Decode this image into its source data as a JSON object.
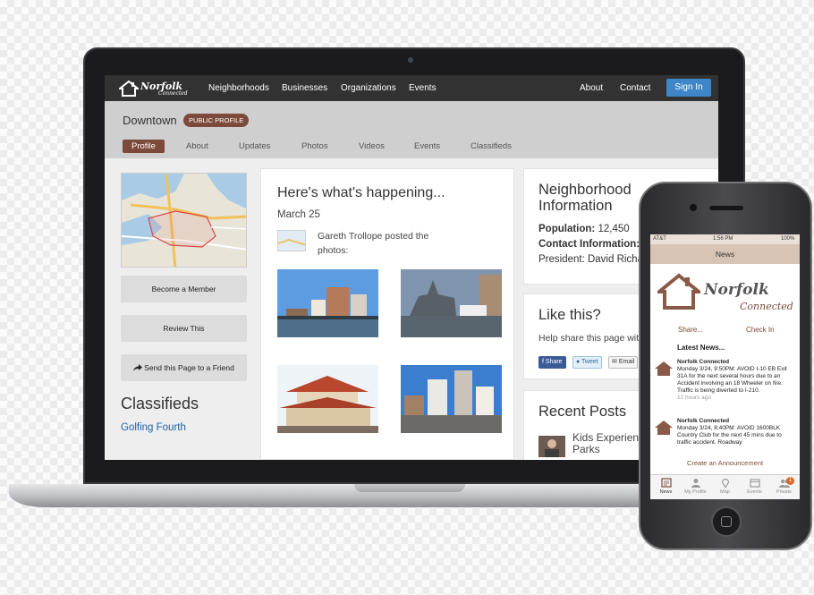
{
  "colors": {
    "brand_brown": "#7b4a3a",
    "nav_dark": "#323232",
    "signin_blue": "#3f86c8",
    "link_blue": "#1e62a6"
  },
  "site": {
    "brand_top": "Norfolk",
    "brand_bottom": "Connected",
    "nav": [
      "Neighborhoods",
      "Businesses",
      "Organizations",
      "Events"
    ],
    "about": "About",
    "contact": "Contact",
    "signin": "Sign In"
  },
  "page": {
    "title": "Downtown",
    "badge": "PUBLIC PROFILE",
    "tabs": [
      "Profile",
      "About",
      "Updates",
      "Photos",
      "Videos",
      "Events",
      "Classifieds"
    ],
    "active_tab": "Profile"
  },
  "sidebar": {
    "buttons": [
      "Become a Member",
      "Review This",
      "Send this Page to a Friend"
    ],
    "classifieds_heading": "Classifieds",
    "classified_link": "Golfing Fourth"
  },
  "feed": {
    "heading": "Here's what's happening...",
    "date": "March 25",
    "post": "Gareth Trollope posted the photos:"
  },
  "info": {
    "heading_line1": "Neighborhood",
    "heading_line2": "Information",
    "population_label": "Population:",
    "population_value": "12,450",
    "contact_label": "Contact Information:",
    "president": "President: David Richa"
  },
  "like": {
    "heading": "Like this?",
    "subtext": "Help share this page wit",
    "share": "Share",
    "tweet": "Tweet",
    "email": "Email"
  },
  "recent": {
    "heading": "Recent Posts",
    "line1": "Kids Experienc",
    "line2": "Parks"
  },
  "phone": {
    "carrier": "AT&T",
    "time": "1:56 PM",
    "battery": "100%",
    "header": "News",
    "logo_top": "Norfolk",
    "logo_bottom": "Connected",
    "share": "Share...",
    "checkin": "Check In",
    "latest": "Latest News...",
    "items": [
      {
        "source": "Norfolk Connected",
        "text": "Monday 3/24, 9:50PM: AVOID I-10 EB Exit 31A for the next several hours due to an Accident involving an 18 Wheeler on fire. Traffic is being diverted to I-210.",
        "ago": "12 hours ago"
      },
      {
        "source": "Norfolk Connected",
        "text": "Monday 3/24, 8:40PM: AVOID 1600BLK Country Club for the next 45 mins due to traffic accident. Roadway"
      }
    ],
    "announce": "Create an Announcement",
    "tabs": [
      "News",
      "My Profile",
      "Map",
      "Events",
      "Private"
    ],
    "badge": "1"
  }
}
